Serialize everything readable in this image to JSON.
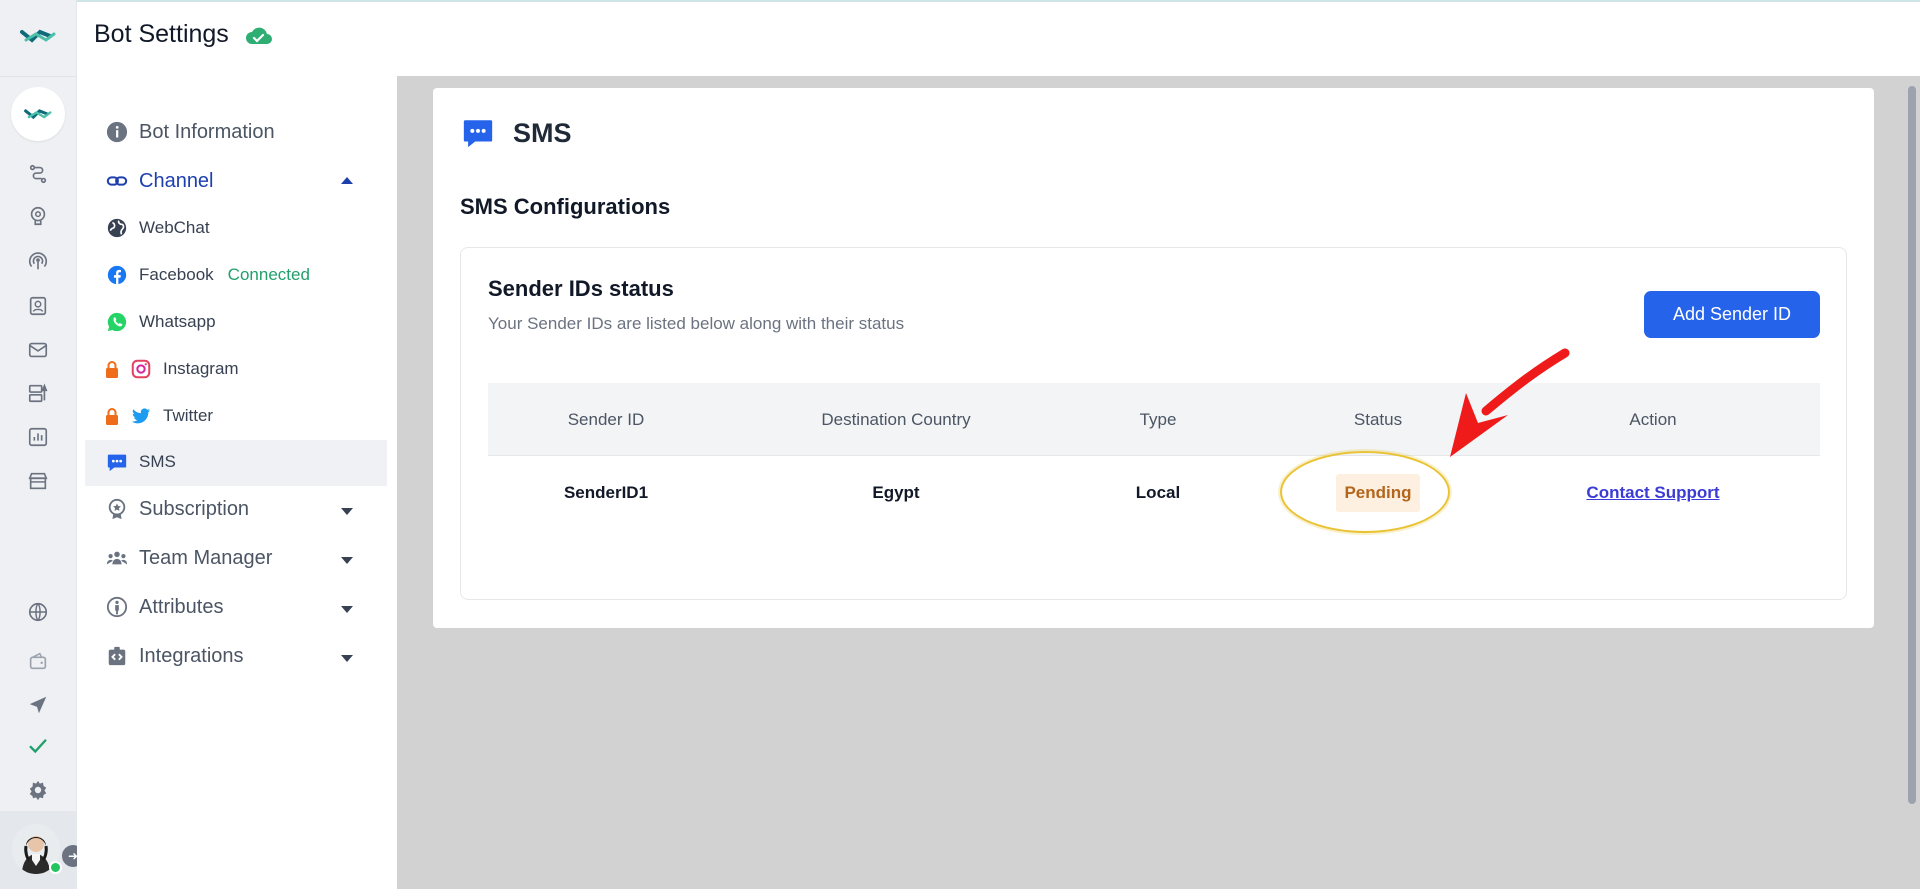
{
  "header": {
    "title": "Bot Settings"
  },
  "settings_nav": {
    "bot_information": "Bot Information",
    "channel": "Channel",
    "channels": [
      {
        "label": "WebChat",
        "icon": "globe-icon",
        "badge": ""
      },
      {
        "label": "Facebook",
        "icon": "facebook-icon",
        "badge": "Connected"
      },
      {
        "label": "Whatsapp",
        "icon": "whatsapp-icon",
        "badge": ""
      },
      {
        "label": "Instagram",
        "icon": "instagram-icon",
        "locked": true
      },
      {
        "label": "Twitter",
        "icon": "twitter-icon",
        "locked": true
      },
      {
        "label": "SMS",
        "icon": "sms-icon",
        "active": true
      }
    ],
    "subscription": "Subscription",
    "team_manager": "Team Manager",
    "attributes": "Attributes",
    "integrations": "Integrations"
  },
  "main": {
    "title": "SMS",
    "section_title": "SMS Configurations",
    "card": {
      "title": "Sender IDs status",
      "subtitle": "Your Sender IDs are listed below along with their status",
      "add_button": "Add Sender ID",
      "columns": [
        "Sender ID",
        "Destination Country",
        "Type",
        "Status",
        "Action"
      ],
      "rows": [
        {
          "sender_id": "SenderID1",
          "country": "Egypt",
          "type": "Local",
          "status": "Pending",
          "action": "Contact Support"
        }
      ]
    }
  },
  "colors": {
    "primary": "#2563eb",
    "connected": "#22a06b",
    "pending_bg": "#fdf0e1",
    "pending_text": "#b4661d",
    "annotation_arrow": "#ef1b1b",
    "annotation_circle": "#e9c334"
  }
}
